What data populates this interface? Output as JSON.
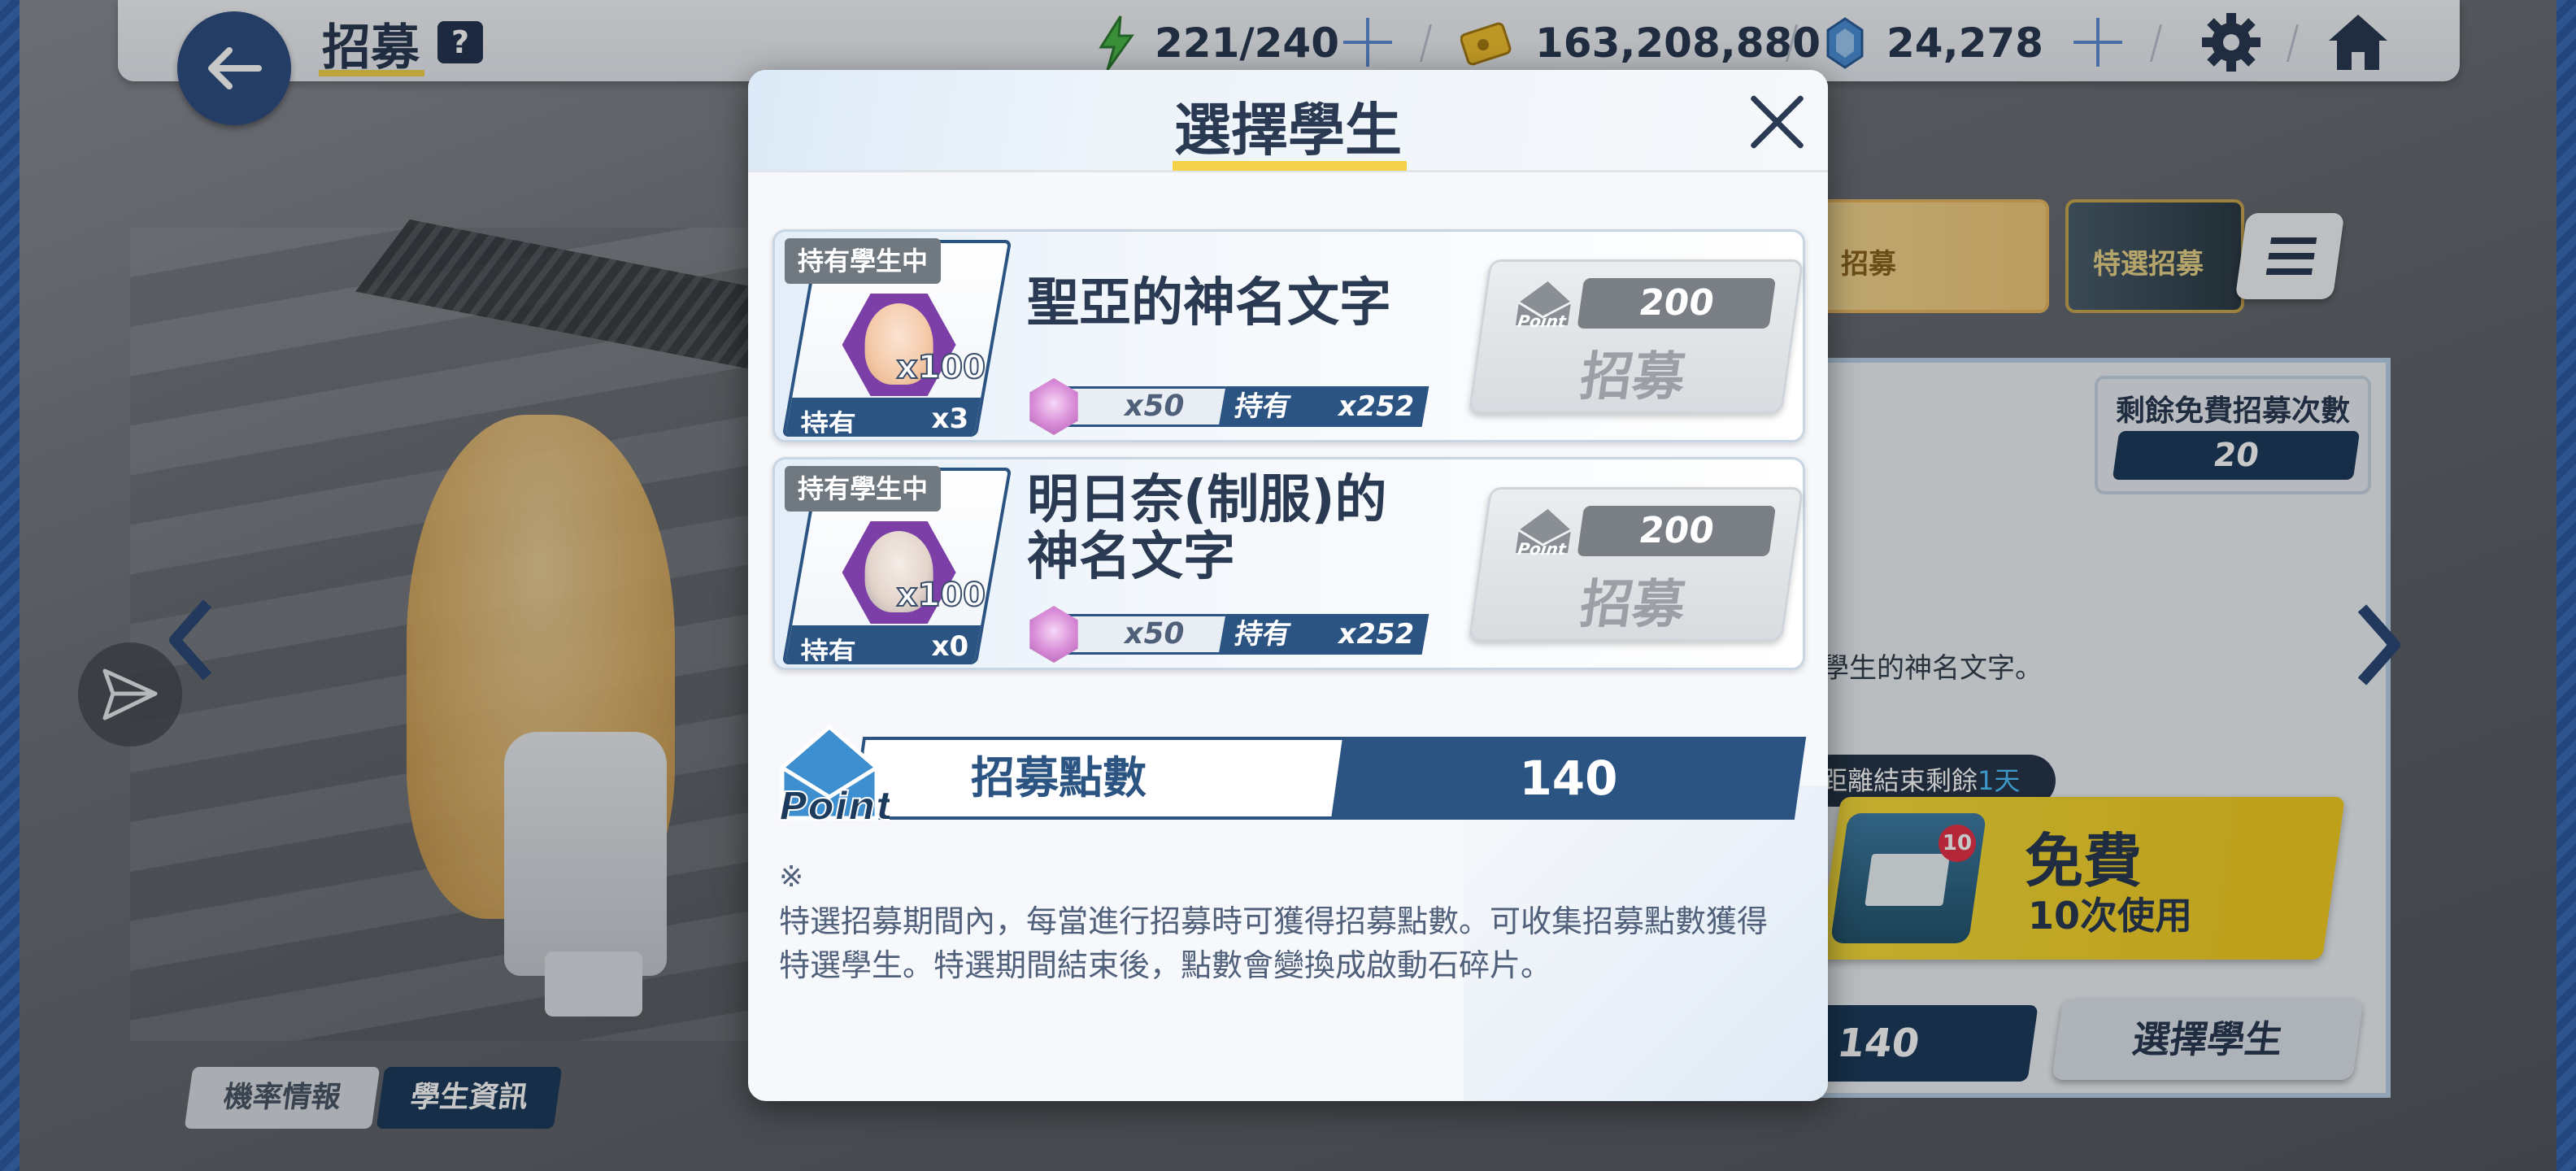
{
  "topbar": {
    "title": "招募",
    "help": "?",
    "ap": "221/240",
    "credits": "163,208,880",
    "pyroxene": "24,278"
  },
  "banners": {
    "tab1_label": "招募",
    "tab2_label": "特選招募"
  },
  "right_panel": {
    "free_count_label": "剩餘免費招募次數",
    "free_count_value": "20",
    "desc": "學生的神名文字。",
    "countdown_label": "距離結束剩餘",
    "countdown_value": "1天",
    "free_title": "免費",
    "free_sub": "10次使用",
    "free_badge": "10",
    "points_value": "140",
    "select_button": "選擇學生"
  },
  "info_tabs": {
    "probability": "機率情報",
    "student_info": "學生資訊"
  },
  "modal": {
    "title": "選擇學生",
    "students": [
      {
        "held_tag": "持有學生中",
        "x100": "x100",
        "held_label": "持有",
        "held_count": "x3",
        "name": "聖亞的神名文字",
        "stone_qty": "x50",
        "stone_held_label": "持有",
        "stone_held_value": "x252",
        "cost": "200",
        "button": "招募"
      },
      {
        "held_tag": "持有學生中",
        "x100": "x100",
        "held_label": "持有",
        "held_count": "x0",
        "name_line1": "明日奈(制服)的",
        "name_line2": "神名文字",
        "stone_qty": "x50",
        "stone_held_label": "持有",
        "stone_held_value": "x252",
        "cost": "200",
        "button": "招募"
      }
    ],
    "points_label": "招募點數",
    "points_value": "140",
    "point_icon_text": "Point",
    "note_mark": "※",
    "note_text": "特選招募期間內，每當進行招募時可獲得招募點數。可收集招募點數獲得特選學生。特選期間結束後，點數會變換成啟動石碎片。"
  },
  "colors": {
    "accent_navy": "#2c5482",
    "highlight_yellow": "#f3d24a",
    "free_yellow": "#f4cd22"
  }
}
